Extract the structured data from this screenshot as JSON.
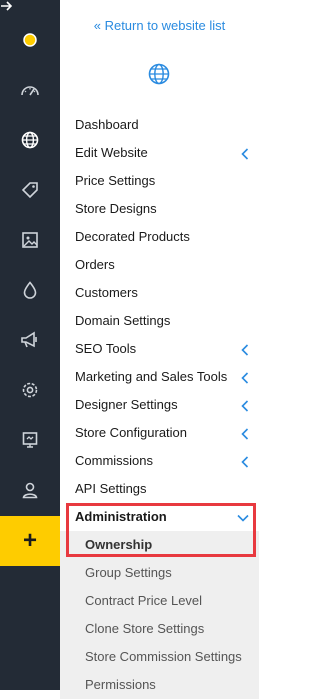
{
  "rail": {
    "icons": [
      "back-arrow-icon",
      "status-dot-icon",
      "speedometer-icon",
      "globe-icon",
      "tag-icon",
      "image-icon",
      "drop-icon",
      "megaphone-icon",
      "gear-icon",
      "presentation-icon",
      "user-icon",
      "plus-icon"
    ],
    "plus_label": "+",
    "accent": "#fecc00"
  },
  "panel": {
    "return_link": "« Return to website list",
    "link_color": "#2a8be0",
    "menu": [
      {
        "label": "Dashboard"
      },
      {
        "label": "Edit Website",
        "submenu": true
      },
      {
        "label": "Price Settings"
      },
      {
        "label": "Store Designs"
      },
      {
        "label": "Decorated Products"
      },
      {
        "label": "Orders"
      },
      {
        "label": "Customers"
      },
      {
        "label": "Domain Settings"
      },
      {
        "label": "SEO Tools",
        "submenu": true
      },
      {
        "label": "Marketing and Sales Tools",
        "submenu": true
      },
      {
        "label": "Designer Settings",
        "submenu": true
      },
      {
        "label": "Store Configuration",
        "submenu": true
      },
      {
        "label": "Commissions",
        "submenu": true
      },
      {
        "label": "API Settings"
      }
    ],
    "active_item": {
      "label": "Administration",
      "expanded": true
    },
    "sub_items": [
      {
        "label": "Ownership",
        "current": true
      },
      {
        "label": "Group Settings"
      },
      {
        "label": "Contract Price Level"
      },
      {
        "label": "Clone Store Settings"
      },
      {
        "label": "Store Commission Settings"
      },
      {
        "label": "Permissions"
      }
    ],
    "highlight_color": "#e8393f"
  }
}
